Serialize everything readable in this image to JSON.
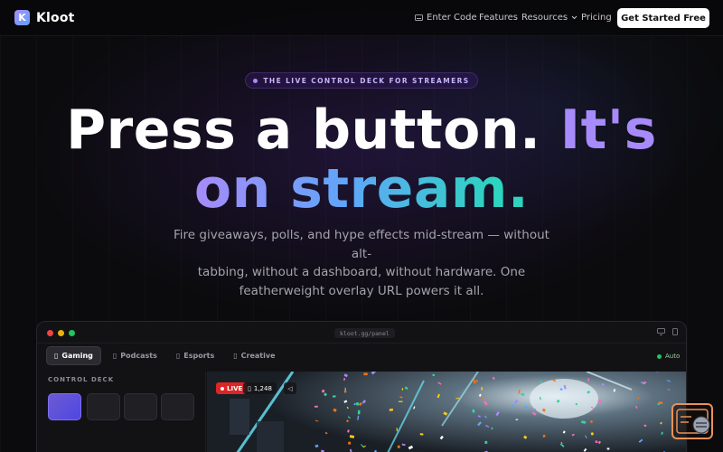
{
  "nav": {
    "logo_letter": "K",
    "brand": "Kloot",
    "enter_code": "Enter Code",
    "features": "Features",
    "resources": "Resources",
    "pricing": "Pricing",
    "cta": "Get Started Free"
  },
  "hero": {
    "eyebrow": "THE LIVE CONTROL DECK FOR STREAMERS",
    "headline_part1": "Press a button. ",
    "headline_part2": "It's",
    "headline_part3": "on stream.",
    "sub_line1": "Fire giveaways, polls, and hype effects mid-stream — without alt-",
    "sub_line2": "tabbing, without a dashboard, without hardware. One",
    "sub_line3": "featherweight overlay URL powers it all."
  },
  "panel": {
    "url": "kloot.gg/panel",
    "tabs": [
      {
        "label": "Gaming",
        "icon": "gamepad-icon"
      },
      {
        "label": "Podcasts",
        "icon": "mic-icon"
      },
      {
        "label": "Esports",
        "icon": "trophy-icon"
      },
      {
        "label": "Creative",
        "icon": "palette-icon"
      }
    ],
    "auto_label": "Auto",
    "deck_label": "CONTROL DECK",
    "live_label": "LIVE",
    "viewers": "1,248"
  },
  "colors": {
    "accent": "#a78bfa",
    "blue": "#60a5fa",
    "teal": "#2dd4bf",
    "live": "#dc2626",
    "auto": "#22c55e"
  }
}
